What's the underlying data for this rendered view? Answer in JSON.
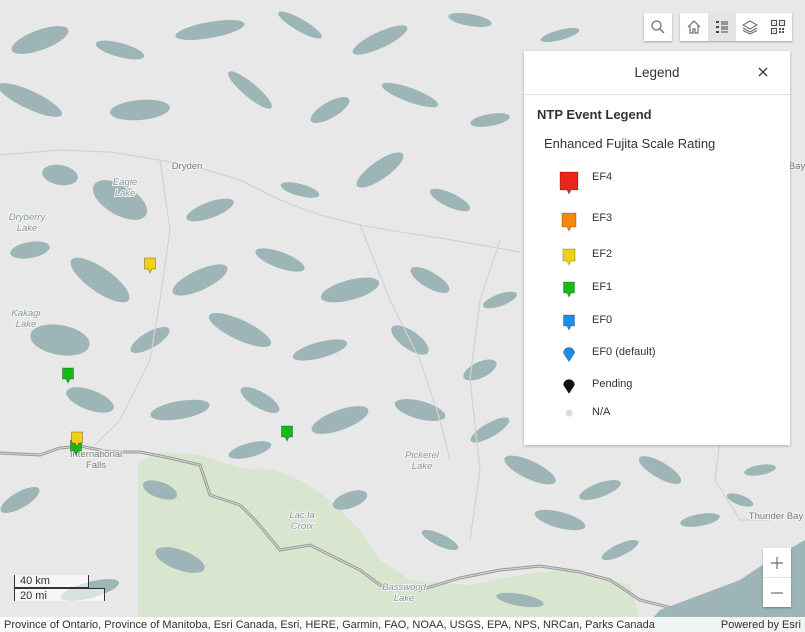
{
  "map": {
    "place_labels": [
      "Dryden",
      "Eagle\nLake",
      "Dryberry\nLake",
      "Kakagi\nLake",
      "International\nFalls",
      "Pickerel\nLake",
      "Lac la\nCroix",
      "Basswood\nLake",
      "Thunder Bay",
      "Bay"
    ],
    "markers": [
      {
        "category": "EF2",
        "color": "#f2d019"
      },
      {
        "category": "EF1",
        "color": "#18b918"
      },
      {
        "category": "EF1",
        "color": "#18b918"
      },
      {
        "category": "EF1",
        "color": "#18b918"
      },
      {
        "category": "EF2",
        "color": "#f2d019"
      }
    ]
  },
  "toolbar": {
    "icons": [
      "search-icon",
      "home-icon",
      "legend-list-icon",
      "layers-icon",
      "qr-code-icon"
    ],
    "active": "legend-list-icon"
  },
  "legend": {
    "title": "Legend",
    "layer_title": "NTP Event Legend",
    "field_title": "Enhanced Fujita Scale Rating",
    "items": [
      {
        "label": "EF4",
        "color": "#e8261e"
      },
      {
        "label": "EF3",
        "color": "#f2880c"
      },
      {
        "label": "EF2",
        "color": "#f2d019"
      },
      {
        "label": "EF1",
        "color": "#18b918"
      },
      {
        "label": "EF0",
        "color": "#1c8ee8"
      },
      {
        "label": "EF0 (default)",
        "color": "#1c8ee8"
      },
      {
        "label": "Pending",
        "color": "#111111"
      },
      {
        "label": "N/A",
        "color": "#dcdcdc"
      }
    ]
  },
  "scale": {
    "km_label": "40 km",
    "mi_label": "20 mi"
  },
  "zoom": {
    "in": "+",
    "out": "−"
  },
  "attribution": {
    "sources": "Province of Ontario, Province of Manitoba, Esri Canada, Esri, HERE, Garmin, FAO, NOAA, USGS, EPA, NPS, NRCan, Parks Canada",
    "powered_by": "Powered by Esri"
  },
  "colors": {
    "water": "#9db5b6",
    "land": "#e8e8e8",
    "park": "#d8e6cf",
    "border": "#9a9a9a"
  }
}
